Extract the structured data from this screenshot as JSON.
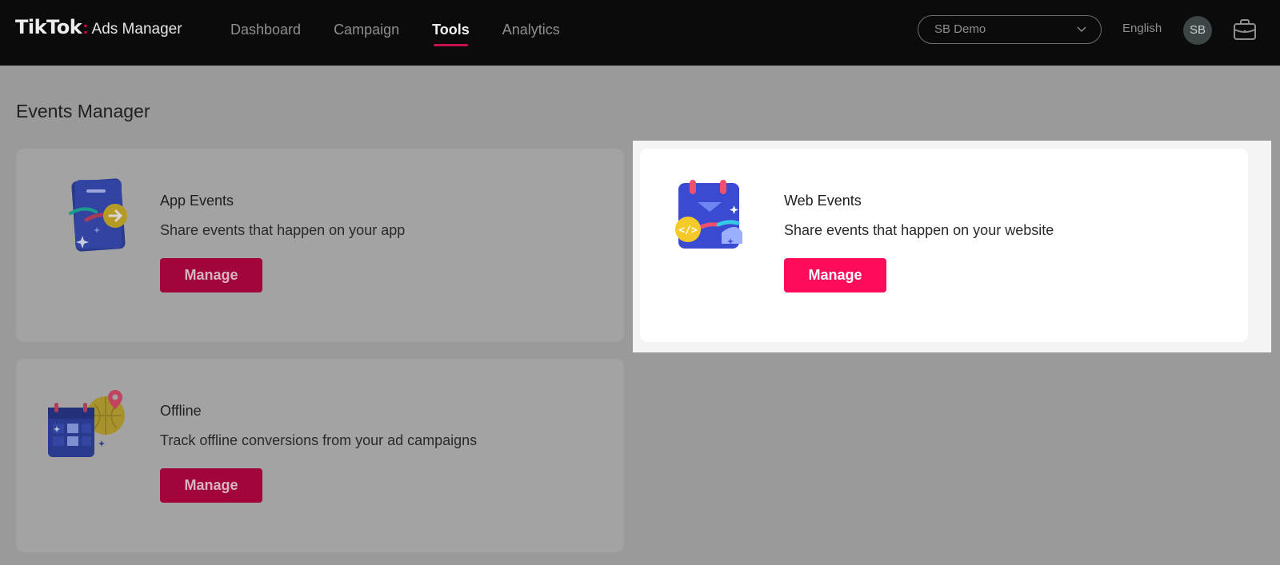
{
  "header": {
    "logo_brand": "TikTok",
    "logo_colon": ":",
    "logo_product": "Ads Manager",
    "nav": [
      {
        "label": "Dashboard",
        "active": false
      },
      {
        "label": "Campaign",
        "active": false
      },
      {
        "label": "Tools",
        "active": true
      },
      {
        "label": "Analytics",
        "active": false
      }
    ],
    "account_selector": "SB Demo",
    "language": "English",
    "avatar_initials": "SB",
    "icons": [
      "chevron-down-icon",
      "briefcase-icon"
    ]
  },
  "page": {
    "title": "Events Manager",
    "cards": [
      {
        "id": "app",
        "title": "App Events",
        "description": "Share events that happen on your app",
        "button": "Manage",
        "icon": "app-events-icon"
      },
      {
        "id": "web",
        "title": "Web Events",
        "description": "Share events that happen on your website",
        "button": "Manage",
        "icon": "web-events-icon",
        "highlighted": true
      },
      {
        "id": "offline",
        "title": "Offline",
        "description": "Track offline conversions from your ad campaigns",
        "button": "Manage",
        "icon": "offline-events-icon"
      }
    ]
  },
  "colors": {
    "accent": "#fe0c5a",
    "nav_underline": "#c8104a",
    "topbar": "#0b0b0b",
    "overlay_bg": "#9a9a9a"
  }
}
